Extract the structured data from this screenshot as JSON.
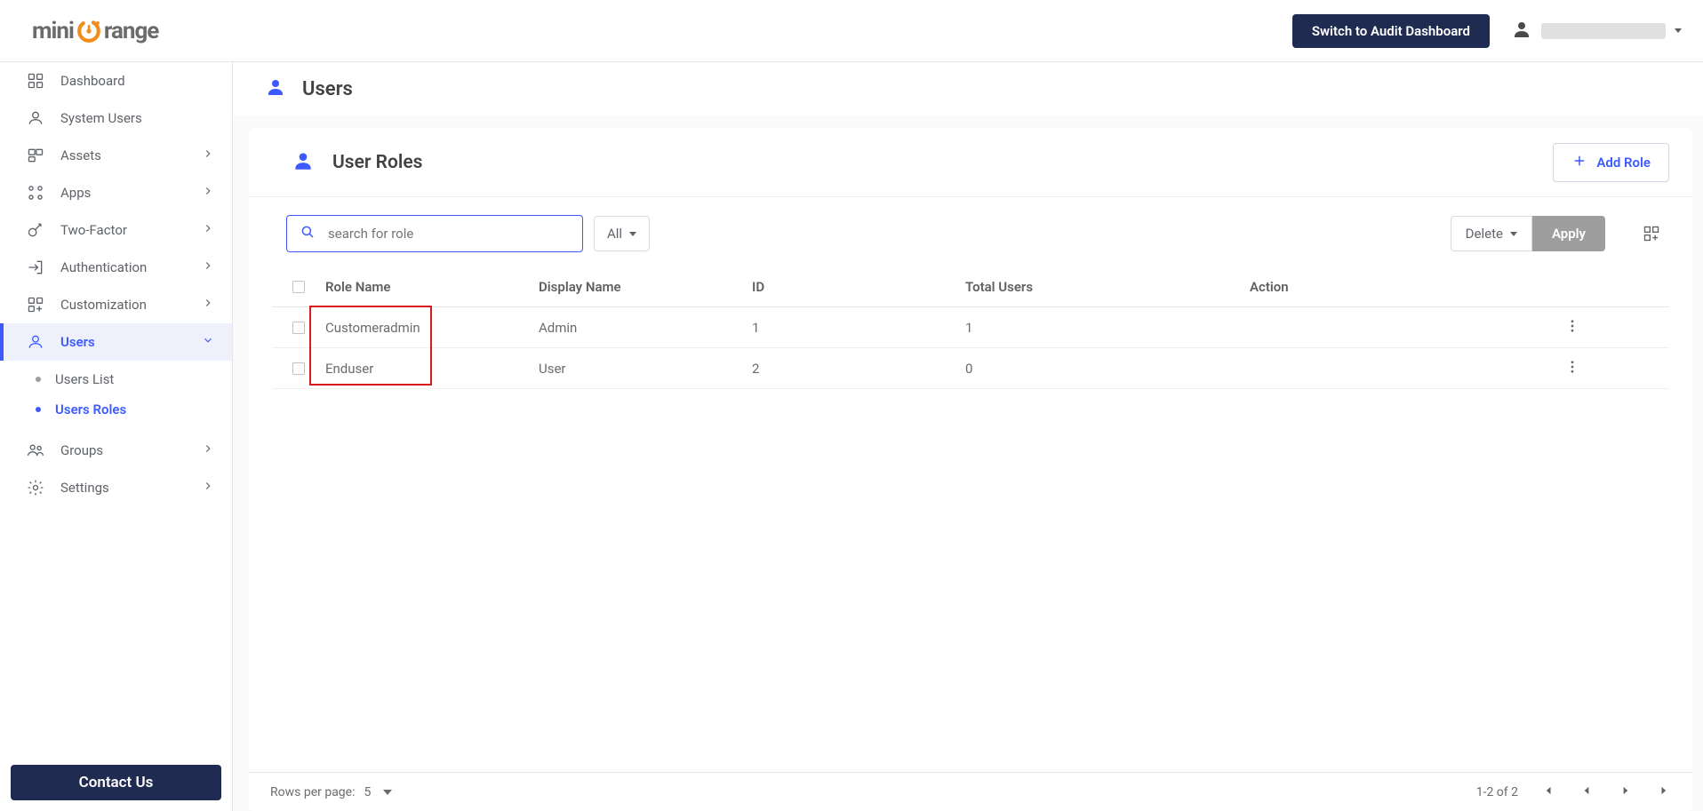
{
  "brand": {
    "part1": "mini",
    "part2": "range"
  },
  "top": {
    "switch_label": "Switch to Audit Dashboard"
  },
  "sidebar": {
    "items": [
      {
        "label": "Dashboard"
      },
      {
        "label": "System Users"
      },
      {
        "label": "Assets"
      },
      {
        "label": "Apps"
      },
      {
        "label": "Two-Factor"
      },
      {
        "label": "Authentication"
      },
      {
        "label": "Customization"
      },
      {
        "label": "Users"
      },
      {
        "label": "Groups"
      },
      {
        "label": "Settings"
      }
    ],
    "users_sub": [
      {
        "label": "Users List"
      },
      {
        "label": "Users Roles"
      }
    ],
    "contact_label": "Contact Us"
  },
  "main": {
    "page_title": "Users",
    "section_title": "User Roles",
    "add_role_label": "Add Role",
    "search_placeholder": "search for role",
    "filter_label": "All",
    "delete_label": "Delete",
    "apply_label": "Apply",
    "columns": {
      "c1": "Role Name",
      "c2": "Display Name",
      "c3": "ID",
      "c4": "Total Users",
      "c5": "Action"
    },
    "rows": [
      {
        "role": "Customeradmin",
        "display": "Admin",
        "id": "1",
        "total": "1"
      },
      {
        "role": "Enduser",
        "display": "User",
        "id": "2",
        "total": "0"
      }
    ],
    "pagination": {
      "per_page_label": "Rows per page:",
      "per_page_value": "5",
      "range": "1-2 of 2"
    }
  }
}
